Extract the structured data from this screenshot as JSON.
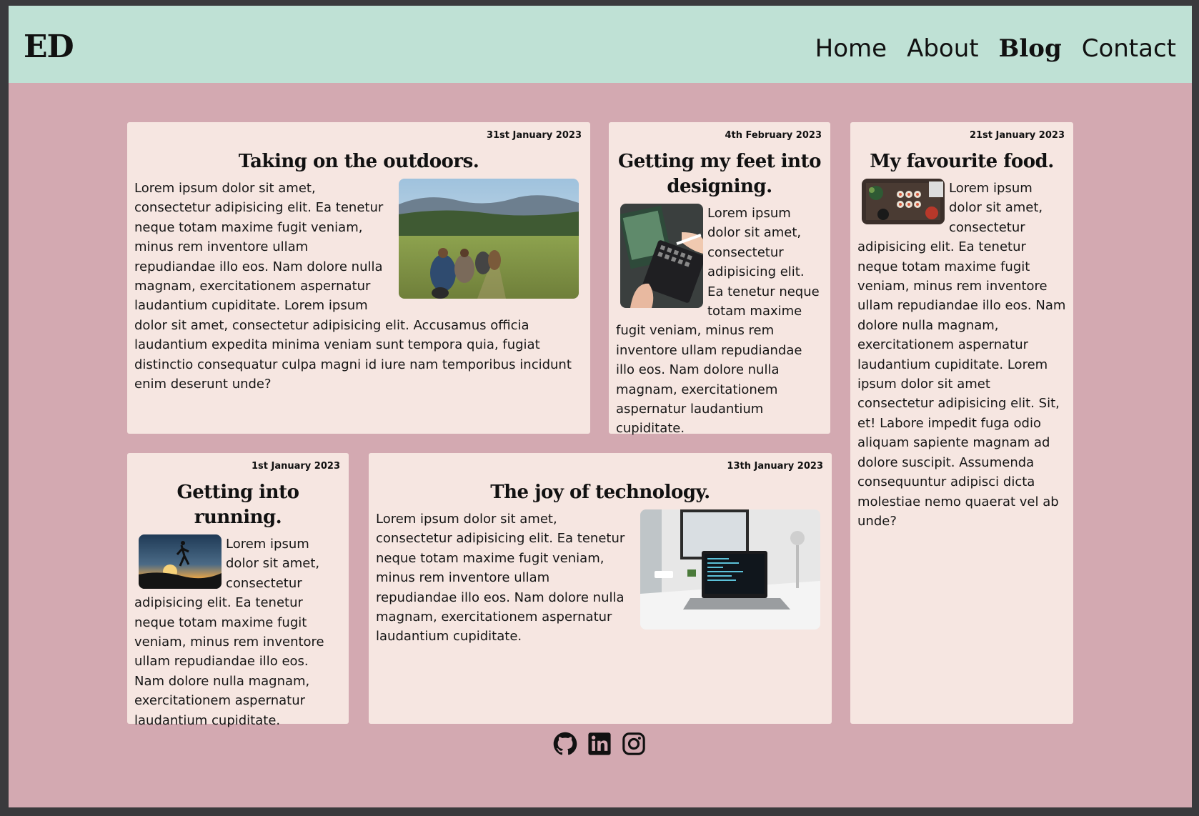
{
  "logo": "ED",
  "nav": [
    {
      "label": "Home",
      "active": false
    },
    {
      "label": "About",
      "active": false
    },
    {
      "label": "Blog",
      "active": true
    },
    {
      "label": "Contact",
      "active": false
    }
  ],
  "posts": [
    {
      "date": "31st January 2023",
      "title": "Taking on the outdoors.",
      "body": "Lorem ipsum dolor sit amet, consectetur adipisicing elit. Ea tenetur neque totam maxime fugit veniam, minus rem inventore ullam repudiandae illo eos. Nam dolore nulla magnam, exercitationem aspernatur laudantium cupiditate. Lorem ipsum dolor sit amet, consectetur adipisicing elit. Accusamus officia laudantium expedita minima veniam sunt tempora quia, fugiat distinctio consequatur culpa magni id iure nam temporibus incidunt enim deserunt unde?"
    },
    {
      "date": "4th February 2023",
      "title": "Getting my feet into designing.",
      "body": "Lorem ipsum dolor sit amet, consectetur adipisicing elit. Ea tenetur neque totam maxime fugit veniam, minus rem inventore ullam repudiandae illo eos. Nam dolore nulla magnam, exercitationem aspernatur laudantium cupiditate."
    },
    {
      "date": "21st January 2023",
      "title": "My favourite food.",
      "body": "Lorem ipsum dolor sit amet, consectetur adipisicing elit. Ea tenetur neque totam maxime fugit veniam, minus rem inventore ullam repudiandae illo eos. Nam dolore nulla magnam, exercitationem aspernatur laudantium cupiditate. Lorem ipsum dolor sit amet consectetur adipisicing elit. Sit, et! Labore impedit fuga odio aliquam sapiente magnam ad dolore suscipit. Assumenda consequuntur adipisci dicta molestiae nemo quaerat vel ab unde?"
    },
    {
      "date": "1st January 2023",
      "title": "Getting into running.",
      "body": "Lorem ipsum dolor sit amet, consectetur adipisicing elit. Ea tenetur neque totam maxime fugit veniam, minus rem inventore ullam repudiandae illo eos. Nam dolore nulla magnam, exercitationem aspernatur laudantium cupiditate."
    },
    {
      "date": "13th January 2023",
      "title": "The joy of technology.",
      "body": "Lorem ipsum dolor sit amet, consectetur adipisicing elit. Ea tenetur neque totam maxime fugit veniam, minus rem inventore ullam repudiandae illo eos. Nam dolore nulla magnam, exercitationem aspernatur laudantium cupiditate."
    }
  ],
  "socials": [
    "github-icon",
    "linkedin-icon",
    "instagram-icon"
  ],
  "colors": {
    "header_bg": "#bfe1d5",
    "page_bg": "#d3a9b1",
    "card_bg": "#f6e6e1"
  }
}
